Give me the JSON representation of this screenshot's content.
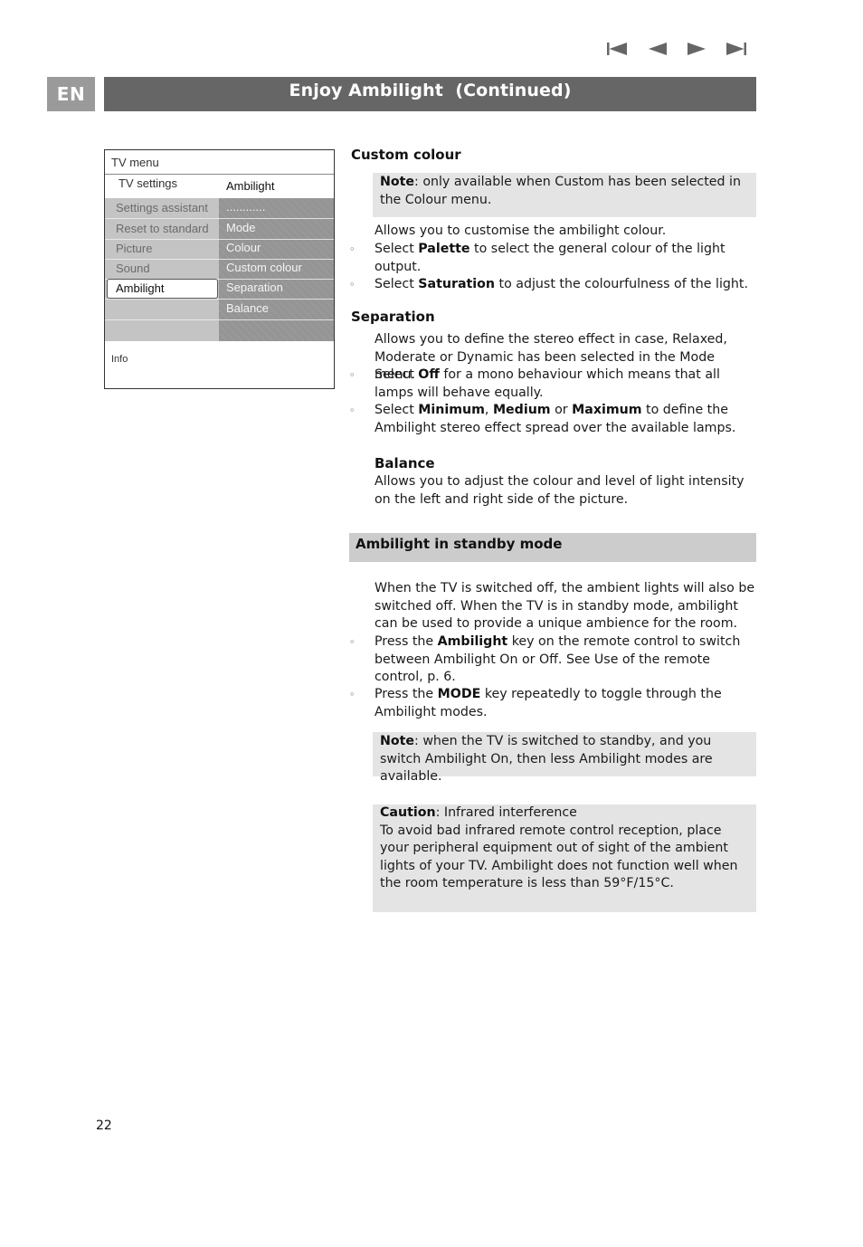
{
  "navigation": {
    "buttons": [
      {
        "name": "first-page-icon",
        "label": "first page"
      },
      {
        "name": "previous-page-icon",
        "label": "previous page"
      },
      {
        "name": "next-page-icon",
        "label": "next page"
      },
      {
        "name": "last-page-icon",
        "label": "last page"
      }
    ]
  },
  "header": {
    "language": "EN",
    "title": "Enjoy Ambilight  (Continued)"
  },
  "tv_menu": {
    "title": "TV menu",
    "submenu_label": "TV settings",
    "submenu_value": "Ambilight",
    "left_items": [
      "Settings assistant",
      "Reset to standard",
      "Picture",
      "Sound",
      "Ambilight",
      "",
      ""
    ],
    "selected_left": "Ambilight",
    "right_items": [
      "............",
      "Mode",
      "Colour",
      "Custom colour",
      "Separation",
      "Balance",
      ""
    ],
    "info_label": "Info"
  },
  "custom_colour": {
    "heading": "Custom colour",
    "note_label": "Note",
    "note_text": ": only available when Custom has been selected in the Colour menu.",
    "intro": "Allows you to customise the ambilight colour.",
    "bullets": [
      {
        "pre": "Select ",
        "bold": "Palette",
        "post": " to select the general colour of the light output."
      },
      {
        "pre": "Select ",
        "bold": "Saturation",
        "post": " to adjust the colourfulness of the light."
      }
    ]
  },
  "separation": {
    "heading": "Separation",
    "intro": "Allows you to define the stereo effect in case, Relaxed, Moderate or Dynamic has been selected in the Mode menu.",
    "bullet1": {
      "pre": "Select ",
      "bold": "Off",
      "post": " for a mono behaviour which means that all lamps will behave equally."
    },
    "bullet2": {
      "pre": "Select ",
      "bold1": "Minimum",
      "sep1": ", ",
      "bold2": "Medium",
      "sep2": " or ",
      "bold3": "Maximum",
      "post": " to define the Ambilight stereo effect spread over the available lamps."
    }
  },
  "balance": {
    "heading": "Balance",
    "text": "Allows you to adjust the colour and level of light intensity on the left and right side of the picture."
  },
  "standby": {
    "heading": "Ambilight in standby mode",
    "intro": "When the TV is switched off, the ambient lights will also be switched off. When the TV is in standby mode, ambilight can be used to provide a unique ambience for the room.",
    "bullets": [
      {
        "pre": "Press the ",
        "bold": "Ambilight",
        "post": " key on the remote control to switch between Ambilight On or Off. See Use of the remote control, p. 6."
      },
      {
        "pre": "Press the ",
        "bold": "MODE",
        "post": " key repeatedly to toggle through the Ambilight modes."
      }
    ],
    "note_label": "Note",
    "note_text": ": when the TV is switched to standby, and you switch Ambilight On, then less Ambilight modes are available."
  },
  "caution": {
    "label": "Caution",
    "subtitle": ": Infrared interference",
    "text": "To avoid bad infrared remote control reception, place your peripheral equipment out of sight of the ambient lights of your TV. Ambilight does not  function well when the room temperature is less than 59°F/15°C."
  },
  "footer": {
    "page_number": "22"
  },
  "bullet_glyph": "◦"
}
